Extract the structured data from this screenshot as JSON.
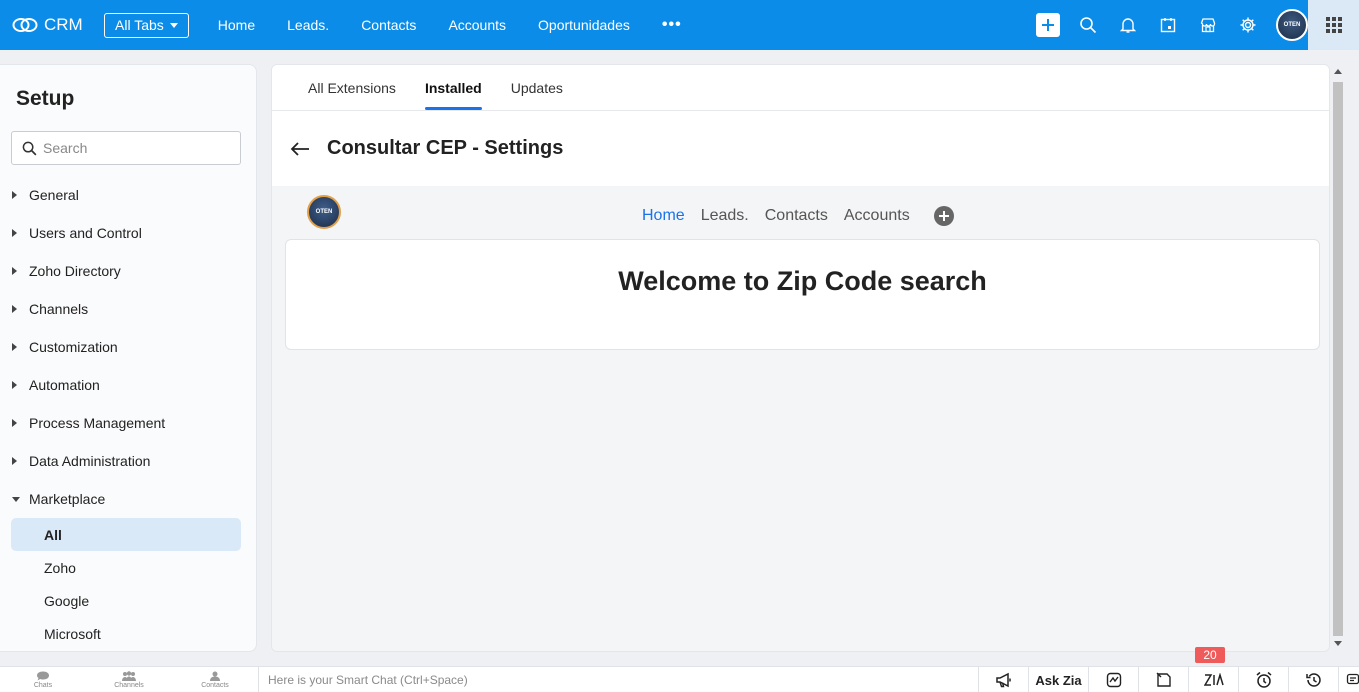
{
  "topbar": {
    "brand": "CRM",
    "all_tabs": "All Tabs",
    "nav": [
      "Home",
      "Leads.",
      "Contacts",
      "Accounts",
      "Oportunidades"
    ],
    "more": "•••",
    "avatar_text": "OTEN",
    "accent_color": "#0a8ce8"
  },
  "sidebar": {
    "title": "Setup",
    "search_placeholder": "Search",
    "items": [
      {
        "label": "General"
      },
      {
        "label": "Users and Control"
      },
      {
        "label": "Zoho Directory"
      },
      {
        "label": "Channels"
      },
      {
        "label": "Customization"
      },
      {
        "label": "Automation"
      },
      {
        "label": "Process Management"
      },
      {
        "label": "Data Administration"
      },
      {
        "label": "Marketplace"
      }
    ],
    "marketplace_sub": [
      "All",
      "Zoho",
      "Google",
      "Microsoft"
    ]
  },
  "main": {
    "tabs": [
      "All Extensions",
      "Installed",
      "Updates"
    ],
    "active_tab": "Installed",
    "settings_title": "Consultar CEP - Settings",
    "extension": {
      "logo_text": "OTEN",
      "nav": [
        "Home",
        "Leads.",
        "Contacts",
        "Accounts"
      ],
      "active_nav": "Home",
      "welcome": "Welcome to Zip Code search"
    }
  },
  "bottombar": {
    "tabs": [
      "Chats",
      "Channels",
      "Contacts"
    ],
    "smart_chat_placeholder": "Here is your Smart Chat (Ctrl+Space)",
    "ask_zia": "Ask Zia",
    "badge_count": "20"
  }
}
